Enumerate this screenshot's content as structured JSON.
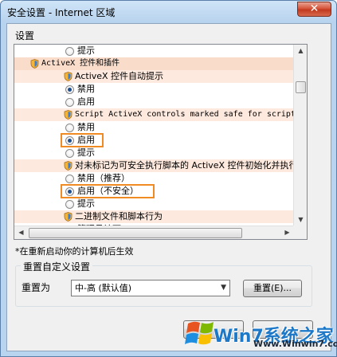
{
  "window": {
    "title": "安全设置 - Internet 区域"
  },
  "settings_group_label": "设置",
  "list": {
    "rows": [
      {
        "kind": "radio",
        "label": "提示",
        "checked": false
      },
      {
        "kind": "category",
        "label": "ActiveX 控件和插件"
      },
      {
        "kind": "subcategory",
        "label": "ActiveX 控件自动提示"
      },
      {
        "kind": "radio",
        "label": "禁用",
        "checked": true
      },
      {
        "kind": "radio",
        "label": "启用",
        "checked": false
      },
      {
        "kind": "subcategory",
        "label": "Script ActiveX controls marked safe for scripting"
      },
      {
        "kind": "radio",
        "label": "禁用",
        "checked": false
      },
      {
        "kind": "radio",
        "label": "启用",
        "checked": true,
        "highlighted": true
      },
      {
        "kind": "radio",
        "label": "提示",
        "checked": false
      },
      {
        "kind": "subcategory",
        "label": "对未标记为可安全执行脚本的 ActiveX 控件初始化并执行"
      },
      {
        "kind": "radio",
        "label": "禁用（推荐）",
        "checked": false
      },
      {
        "kind": "radio",
        "label": "启用（不安全）",
        "checked": true,
        "highlighted": true
      },
      {
        "kind": "radio",
        "label": "提示",
        "checked": false
      },
      {
        "kind": "subcategory",
        "label": "二进制文件和脚本行为"
      },
      {
        "kind": "radio",
        "label": "管理员认可",
        "checked": false
      }
    ]
  },
  "note": "*在重新启动你的计算机后生效",
  "reset": {
    "legend": "重置自定义设置",
    "label": "重置为",
    "selected": "中-高 (默认值)",
    "button": "重置(E)..."
  },
  "watermark": {
    "title": "Win7系统之家",
    "url": "Www.Winwin7.com"
  },
  "colors": {
    "category_bg": "#fadccb",
    "highlight_border": "#f08a24",
    "radio_dot": "#1c4e8f"
  }
}
